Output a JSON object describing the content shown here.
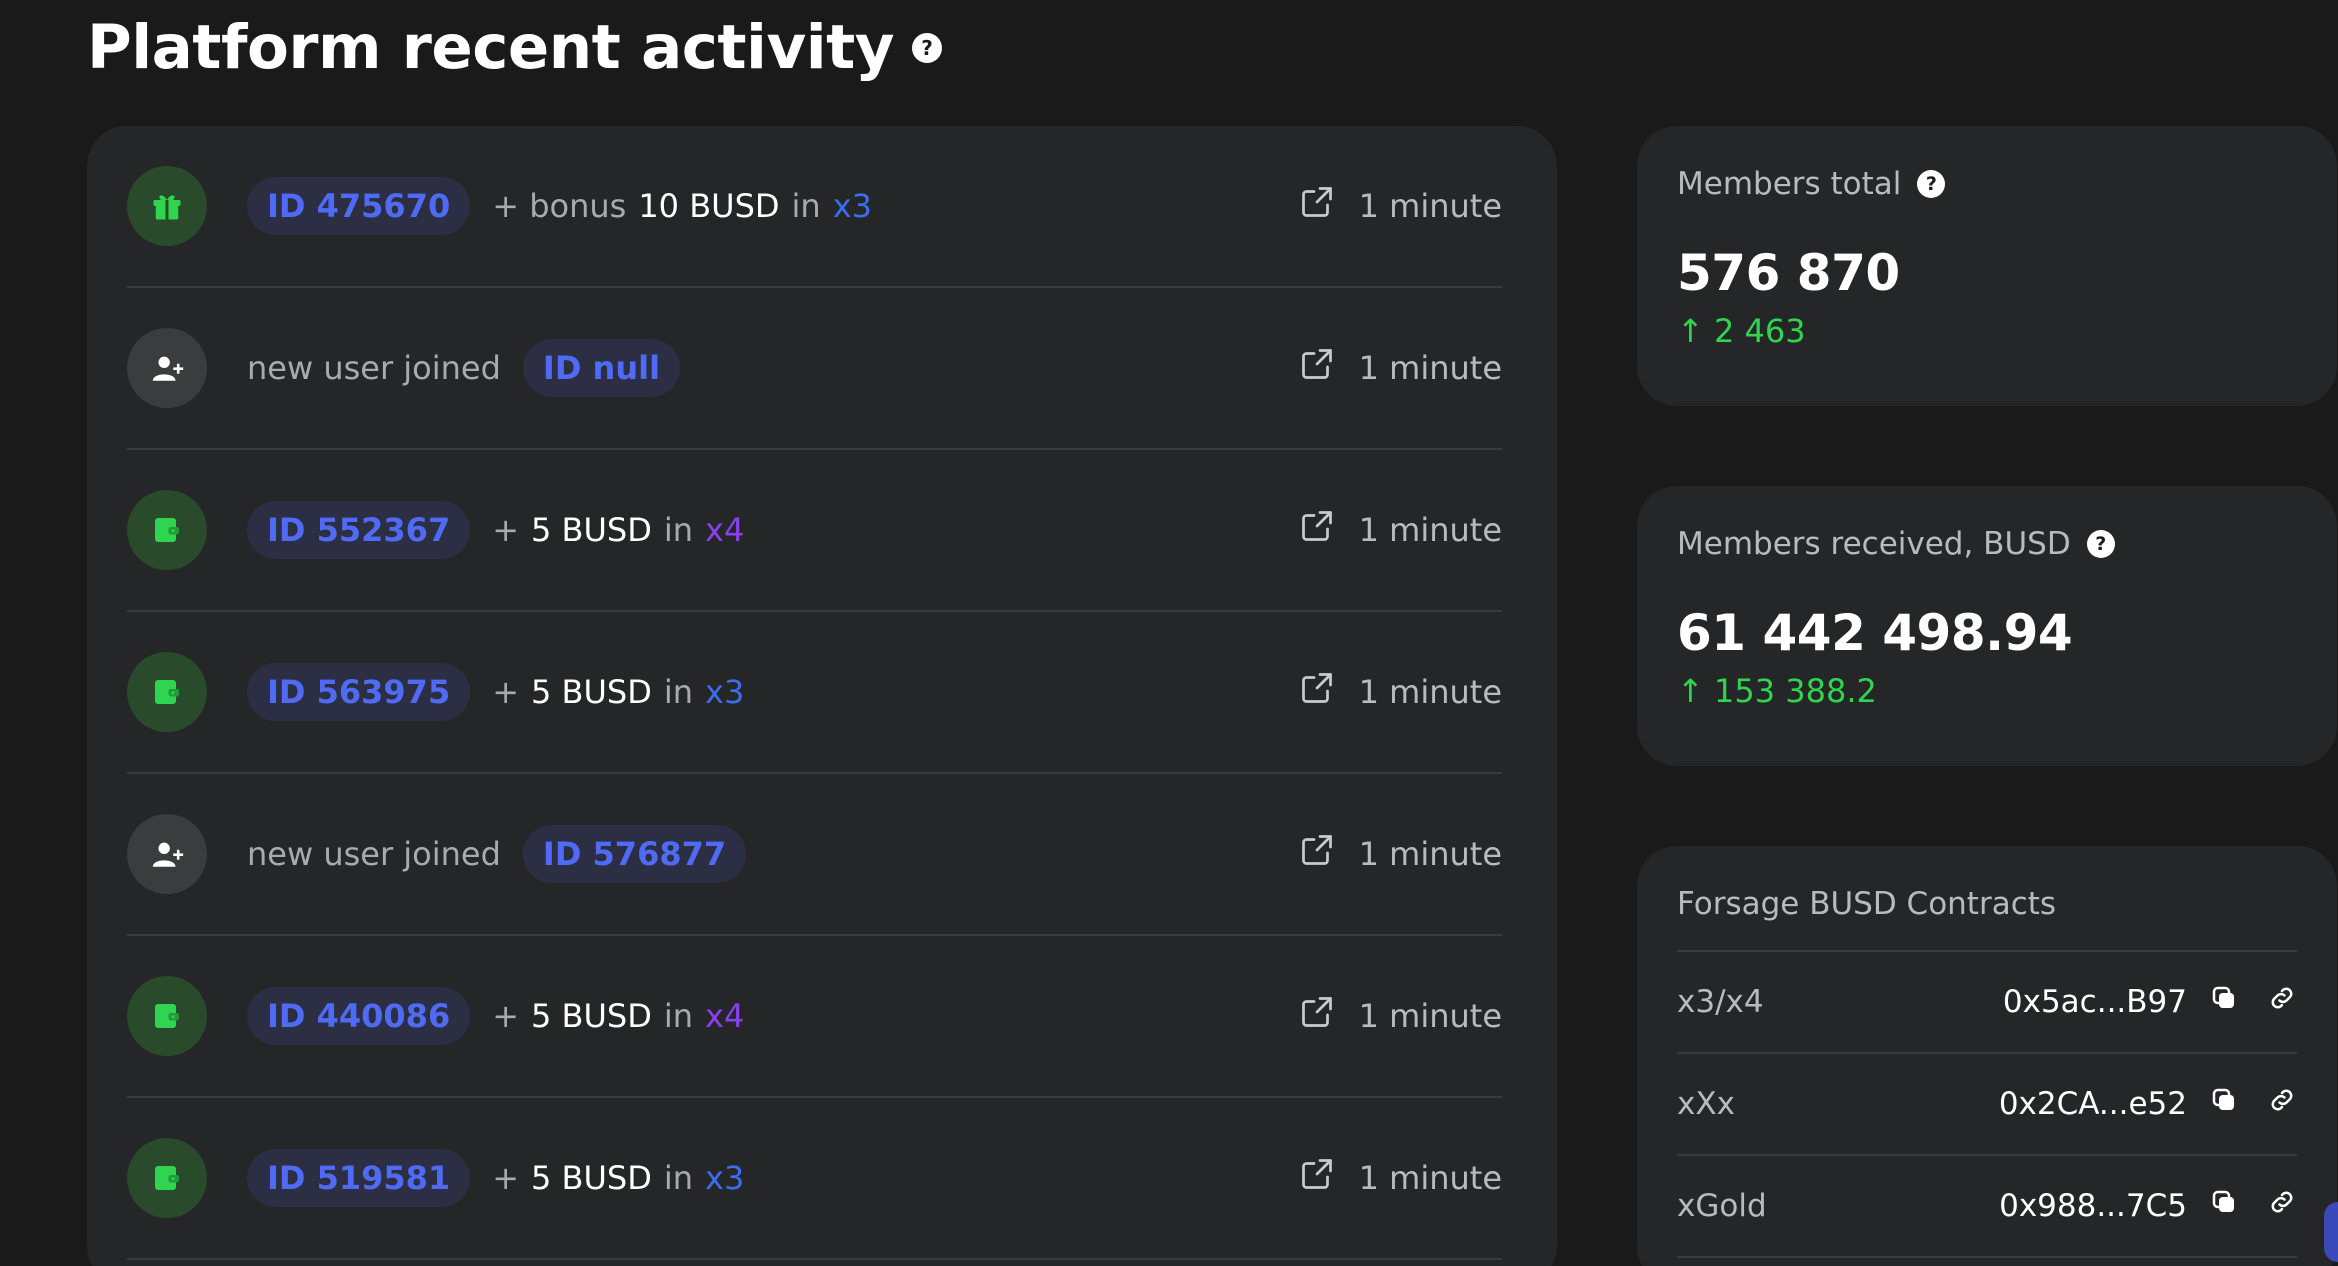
{
  "title": "Platform recent activity",
  "help_mark": "?",
  "activity": [
    {
      "icon": "gift-icon",
      "kind": "bonus",
      "id": "ID 475670",
      "prefix": "+ bonus",
      "amount": "10 BUSD",
      "in": "in",
      "program": "x3",
      "program_color": "x3",
      "time": "1 minute"
    },
    {
      "icon": "user-plus-icon",
      "kind": "join",
      "text": "new user joined",
      "id": "ID null",
      "time": "1 minute"
    },
    {
      "icon": "wallet-icon",
      "kind": "payment",
      "id": "ID 552367",
      "prefix": "+",
      "amount": "5 BUSD",
      "in": "in",
      "program": "x4",
      "program_color": "x4",
      "time": "1 minute"
    },
    {
      "icon": "wallet-icon",
      "kind": "payment",
      "id": "ID 563975",
      "prefix": "+",
      "amount": "5 BUSD",
      "in": "in",
      "program": "x3",
      "program_color": "x3",
      "time": "1 minute"
    },
    {
      "icon": "user-plus-icon",
      "kind": "join",
      "text": "new user joined",
      "id": "ID 576877",
      "time": "1 minute"
    },
    {
      "icon": "wallet-icon",
      "kind": "payment",
      "id": "ID 440086",
      "prefix": "+",
      "amount": "5 BUSD",
      "in": "in",
      "program": "x4",
      "program_color": "x4",
      "time": "1 minute"
    },
    {
      "icon": "wallet-icon",
      "kind": "payment",
      "id": "ID 519581",
      "prefix": "+",
      "amount": "5 BUSD",
      "in": "in",
      "program": "x3",
      "program_color": "x3",
      "time": "1 minute"
    }
  ],
  "members_total": {
    "label": "Members total",
    "value": "576 870",
    "delta": "↑ 2 463"
  },
  "members_received": {
    "label": "Members received, BUSD",
    "value": "61 442 498.94",
    "delta": "↑ 153 388.2"
  },
  "contracts": {
    "label": "Forsage BUSD Contracts",
    "rows": [
      {
        "name": "x3/x4",
        "address": "0x5ac...B97"
      },
      {
        "name": "xXx",
        "address": "0x2CA...e52"
      },
      {
        "name": "xGold",
        "address": "0x988...7C5"
      }
    ]
  },
  "colors": {
    "accent_blue": "#4f6bf5",
    "x3": "#3c6df0",
    "x4": "#8a3ff0",
    "positive": "#2fd54f",
    "icon_green": "#2fd54f"
  }
}
